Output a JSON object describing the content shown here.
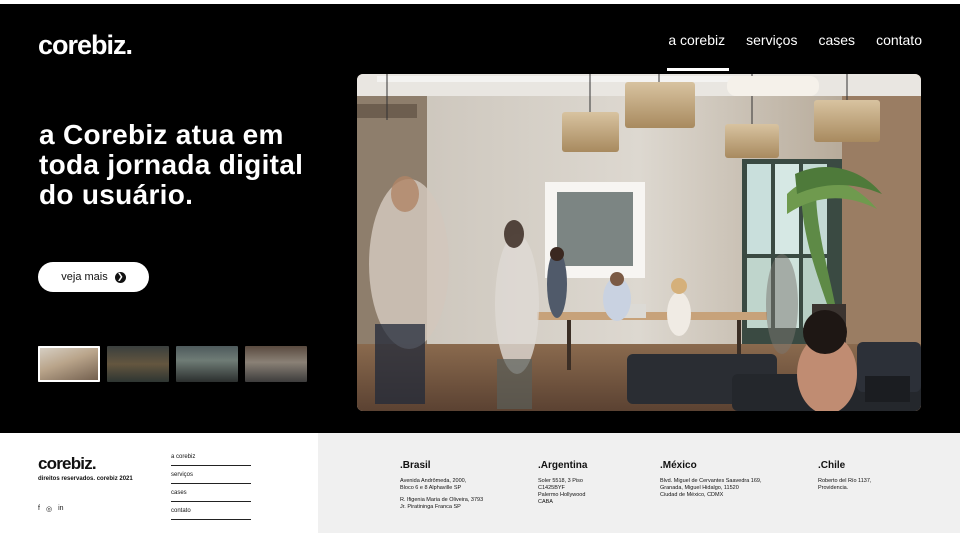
{
  "brand": {
    "name": "corebiz",
    "dot": "."
  },
  "nav": {
    "items": [
      {
        "label": "a corebiz",
        "active": true
      },
      {
        "label": "serviços"
      },
      {
        "label": "cases"
      },
      {
        "label": "contato"
      }
    ]
  },
  "hero": {
    "headline": "a Corebiz atua em toda jornada digital do usuário.",
    "cta_label": "veja mais",
    "cta_icon": "arrow-right-icon",
    "thumbnails": [
      "thumbnail-1",
      "thumbnail-2",
      "thumbnail-3",
      "thumbnail-4"
    ]
  },
  "footer": {
    "rights": "direitos reservados. corebiz 2021",
    "social": [
      {
        "icon": "facebook-icon",
        "glyph": "f"
      },
      {
        "icon": "instagram-icon",
        "glyph": "◎"
      },
      {
        "icon": "linkedin-icon",
        "glyph": "in"
      }
    ],
    "links": [
      "a corebiz",
      "serviços",
      "cases",
      "contato"
    ],
    "offices": [
      {
        "country": ".Brasil",
        "addresses": [
          [
            "Avenida Andrômeda, 2000,",
            "Bloco 6 e 8 Alphaville SP"
          ],
          [
            "R. Ifigenia Maria de Oliveira, 3793",
            "Jr. Piratininga Franca SP"
          ]
        ]
      },
      {
        "country": ".Argentina",
        "addresses": [
          [
            "Soler 5518, 3 Piso",
            "C1425BYF",
            "Palermo Hollywood",
            "CABA"
          ]
        ]
      },
      {
        "country": ".México",
        "addresses": [
          [
            "Blvd. Miguel de Cervantes Saavedra 169,",
            "Granada, Miguel Hidalgo, 11520",
            "Ciudad de México, CDMX"
          ]
        ]
      },
      {
        "country": ".Chile",
        "addresses": [
          [
            "Roberto del Río 1137,",
            "Providencia."
          ]
        ]
      }
    ]
  },
  "colors": {
    "hero_bg": "#000000",
    "footer_right_bg": "#f0f0f0",
    "text_dark": "#111111"
  }
}
